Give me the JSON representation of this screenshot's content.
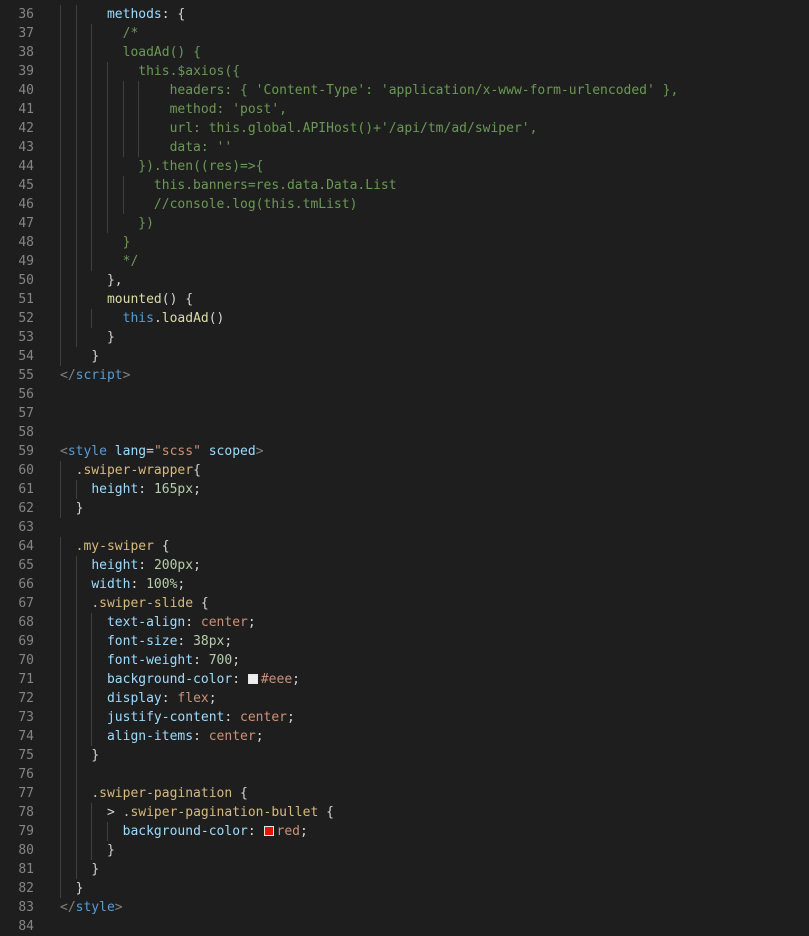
{
  "editor": {
    "colors": {
      "background": "#1e1e1e",
      "line_number": "#858585",
      "indent_guide": "#404040",
      "comment": "#6a9955",
      "property": "#9cdcfe",
      "function": "#dcdcaa",
      "tag": "#569cd6",
      "string": "#ce9178",
      "selector": "#d7ba7d",
      "number": "#b5cea8"
    },
    "lines": [
      {
        "n": "36",
        "t": [
          [
            "      ",
            "plain"
          ],
          [
            "methods",
            "prop"
          ],
          [
            ": {",
            "plain"
          ]
        ]
      },
      {
        "n": "37",
        "t": [
          [
            "        ",
            "plain"
          ],
          [
            "/*",
            "comment"
          ]
        ]
      },
      {
        "n": "38",
        "t": [
          [
            "        ",
            "plain"
          ],
          [
            "loadAd() {",
            "comment"
          ]
        ]
      },
      {
        "n": "39",
        "t": [
          [
            "          ",
            "plain"
          ],
          [
            "this.$axios({",
            "comment"
          ]
        ]
      },
      {
        "n": "40",
        "t": [
          [
            "              ",
            "plain"
          ],
          [
            "headers: { 'Content-Type': 'application/x-www-form-urlencoded' },",
            "comment"
          ]
        ]
      },
      {
        "n": "41",
        "t": [
          [
            "              ",
            "plain"
          ],
          [
            "method: 'post',",
            "comment"
          ]
        ]
      },
      {
        "n": "42",
        "t": [
          [
            "              ",
            "plain"
          ],
          [
            "url: this.global.APIHost()+'/api/tm/ad/swiper',",
            "comment"
          ]
        ]
      },
      {
        "n": "43",
        "t": [
          [
            "              ",
            "plain"
          ],
          [
            "data: ''",
            "comment"
          ]
        ]
      },
      {
        "n": "44",
        "t": [
          [
            "          ",
            "plain"
          ],
          [
            "}).then((res)=>{",
            "comment"
          ]
        ]
      },
      {
        "n": "45",
        "t": [
          [
            "            ",
            "plain"
          ],
          [
            "this.banners=res.data.Data.List",
            "comment"
          ]
        ]
      },
      {
        "n": "46",
        "t": [
          [
            "            ",
            "plain"
          ],
          [
            "//console.log(this.tmList)",
            "comment"
          ]
        ]
      },
      {
        "n": "47",
        "t": [
          [
            "          ",
            "plain"
          ],
          [
            "})",
            "comment"
          ]
        ]
      },
      {
        "n": "48",
        "t": [
          [
            "        ",
            "plain"
          ],
          [
            "}",
            "comment"
          ]
        ]
      },
      {
        "n": "49",
        "t": [
          [
            "        ",
            "plain"
          ],
          [
            "*/",
            "comment"
          ]
        ]
      },
      {
        "n": "50",
        "t": [
          [
            "      ",
            "plain"
          ],
          [
            "},",
            "plain"
          ]
        ]
      },
      {
        "n": "51",
        "t": [
          [
            "      ",
            "plain"
          ],
          [
            "mounted",
            "func"
          ],
          [
            "() {",
            "plain"
          ]
        ]
      },
      {
        "n": "52",
        "t": [
          [
            "        ",
            "plain"
          ],
          [
            "this",
            "keyword"
          ],
          [
            ".",
            "plain"
          ],
          [
            "loadAd",
            "func"
          ],
          [
            "()",
            "plain"
          ]
        ]
      },
      {
        "n": "53",
        "t": [
          [
            "      ",
            "plain"
          ],
          [
            "}",
            "plain"
          ]
        ]
      },
      {
        "n": "54",
        "t": [
          [
            "    ",
            "plain"
          ],
          [
            "}",
            "plain"
          ]
        ]
      },
      {
        "n": "55",
        "t": [
          [
            "",
            "plain"
          ],
          [
            "</",
            "punc"
          ],
          [
            "script",
            "tag"
          ],
          [
            ">",
            "punc"
          ]
        ]
      },
      {
        "n": "56",
        "t": []
      },
      {
        "n": "57",
        "t": []
      },
      {
        "n": "58",
        "t": []
      },
      {
        "n": "59",
        "t": [
          [
            "",
            "plain"
          ],
          [
            "<",
            "punc"
          ],
          [
            "style",
            "tag"
          ],
          [
            " ",
            "plain"
          ],
          [
            "lang",
            "attr"
          ],
          [
            "=",
            "plain"
          ],
          [
            "\"scss\"",
            "string"
          ],
          [
            " ",
            "plain"
          ],
          [
            "scoped",
            "attr"
          ],
          [
            ">",
            "punc"
          ]
        ]
      },
      {
        "n": "60",
        "t": [
          [
            "  ",
            "plain"
          ],
          [
            ".swiper-wrapper",
            "selector"
          ],
          [
            "{",
            "plain"
          ]
        ]
      },
      {
        "n": "61",
        "t": [
          [
            "    ",
            "plain"
          ],
          [
            "height",
            "prop"
          ],
          [
            ": ",
            "plain"
          ],
          [
            "165px",
            "num"
          ],
          [
            ";",
            "plain"
          ]
        ]
      },
      {
        "n": "62",
        "t": [
          [
            "  ",
            "plain"
          ],
          [
            "}",
            "plain"
          ]
        ]
      },
      {
        "n": "63",
        "t": []
      },
      {
        "n": "64",
        "t": [
          [
            "  ",
            "plain"
          ],
          [
            ".my-swiper",
            "selector"
          ],
          [
            " {",
            "plain"
          ]
        ]
      },
      {
        "n": "65",
        "t": [
          [
            "    ",
            "plain"
          ],
          [
            "height",
            "prop"
          ],
          [
            ": ",
            "plain"
          ],
          [
            "200px",
            "num"
          ],
          [
            ";",
            "plain"
          ]
        ]
      },
      {
        "n": "66",
        "t": [
          [
            "    ",
            "plain"
          ],
          [
            "width",
            "prop"
          ],
          [
            ": ",
            "plain"
          ],
          [
            "100%",
            "num"
          ],
          [
            ";",
            "plain"
          ]
        ]
      },
      {
        "n": "67",
        "t": [
          [
            "    ",
            "plain"
          ],
          [
            ".swiper-slide",
            "selector"
          ],
          [
            " {",
            "plain"
          ]
        ]
      },
      {
        "n": "68",
        "t": [
          [
            "      ",
            "plain"
          ],
          [
            "text-align",
            "prop"
          ],
          [
            ": ",
            "plain"
          ],
          [
            "center",
            "value"
          ],
          [
            ";",
            "plain"
          ]
        ]
      },
      {
        "n": "69",
        "t": [
          [
            "      ",
            "plain"
          ],
          [
            "font-size",
            "prop"
          ],
          [
            ": ",
            "plain"
          ],
          [
            "38px",
            "num"
          ],
          [
            ";",
            "plain"
          ]
        ]
      },
      {
        "n": "70",
        "t": [
          [
            "      ",
            "plain"
          ],
          [
            "font-weight",
            "prop"
          ],
          [
            ": ",
            "plain"
          ],
          [
            "700",
            "num"
          ],
          [
            ";",
            "plain"
          ]
        ]
      },
      {
        "n": "71",
        "t": [
          [
            "      ",
            "plain"
          ],
          [
            "background-color",
            "prop"
          ],
          [
            ": ",
            "plain"
          ],
          [
            "#eee",
            "value",
            "#eeeeee"
          ],
          [
            ";",
            "plain"
          ]
        ]
      },
      {
        "n": "72",
        "t": [
          [
            "      ",
            "plain"
          ],
          [
            "display",
            "prop"
          ],
          [
            ": ",
            "plain"
          ],
          [
            "flex",
            "value"
          ],
          [
            ";",
            "plain"
          ]
        ]
      },
      {
        "n": "73",
        "t": [
          [
            "      ",
            "plain"
          ],
          [
            "justify-content",
            "prop"
          ],
          [
            ": ",
            "plain"
          ],
          [
            "center",
            "value"
          ],
          [
            ";",
            "plain"
          ]
        ]
      },
      {
        "n": "74",
        "t": [
          [
            "      ",
            "plain"
          ],
          [
            "align-items",
            "prop"
          ],
          [
            ": ",
            "plain"
          ],
          [
            "center",
            "value"
          ],
          [
            ";",
            "plain"
          ]
        ]
      },
      {
        "n": "75",
        "t": [
          [
            "    ",
            "plain"
          ],
          [
            "}",
            "plain"
          ]
        ]
      },
      {
        "n": "76",
        "t": []
      },
      {
        "n": "77",
        "t": [
          [
            "    ",
            "plain"
          ],
          [
            ".swiper-pagination",
            "selector"
          ],
          [
            " {",
            "plain"
          ]
        ]
      },
      {
        "n": "78",
        "t": [
          [
            "      ",
            "plain"
          ],
          [
            "> ",
            "plain"
          ],
          [
            ".swiper-pagination-bullet",
            "selector"
          ],
          [
            " {",
            "plain"
          ]
        ]
      },
      {
        "n": "79",
        "t": [
          [
            "        ",
            "plain"
          ],
          [
            "background-color",
            "prop"
          ],
          [
            ": ",
            "plain"
          ],
          [
            "red",
            "value",
            "#ff0000"
          ],
          [
            ";",
            "plain"
          ]
        ]
      },
      {
        "n": "80",
        "t": [
          [
            "      ",
            "plain"
          ],
          [
            "}",
            "plain"
          ]
        ]
      },
      {
        "n": "81",
        "t": [
          [
            "    ",
            "plain"
          ],
          [
            "}",
            "plain"
          ]
        ]
      },
      {
        "n": "82",
        "t": [
          [
            "  ",
            "plain"
          ],
          [
            "}",
            "plain"
          ]
        ]
      },
      {
        "n": "83",
        "t": [
          [
            "",
            "plain"
          ],
          [
            "</",
            "punc"
          ],
          [
            "style",
            "tag"
          ],
          [
            ">",
            "punc"
          ]
        ]
      },
      {
        "n": "84",
        "t": []
      }
    ]
  }
}
